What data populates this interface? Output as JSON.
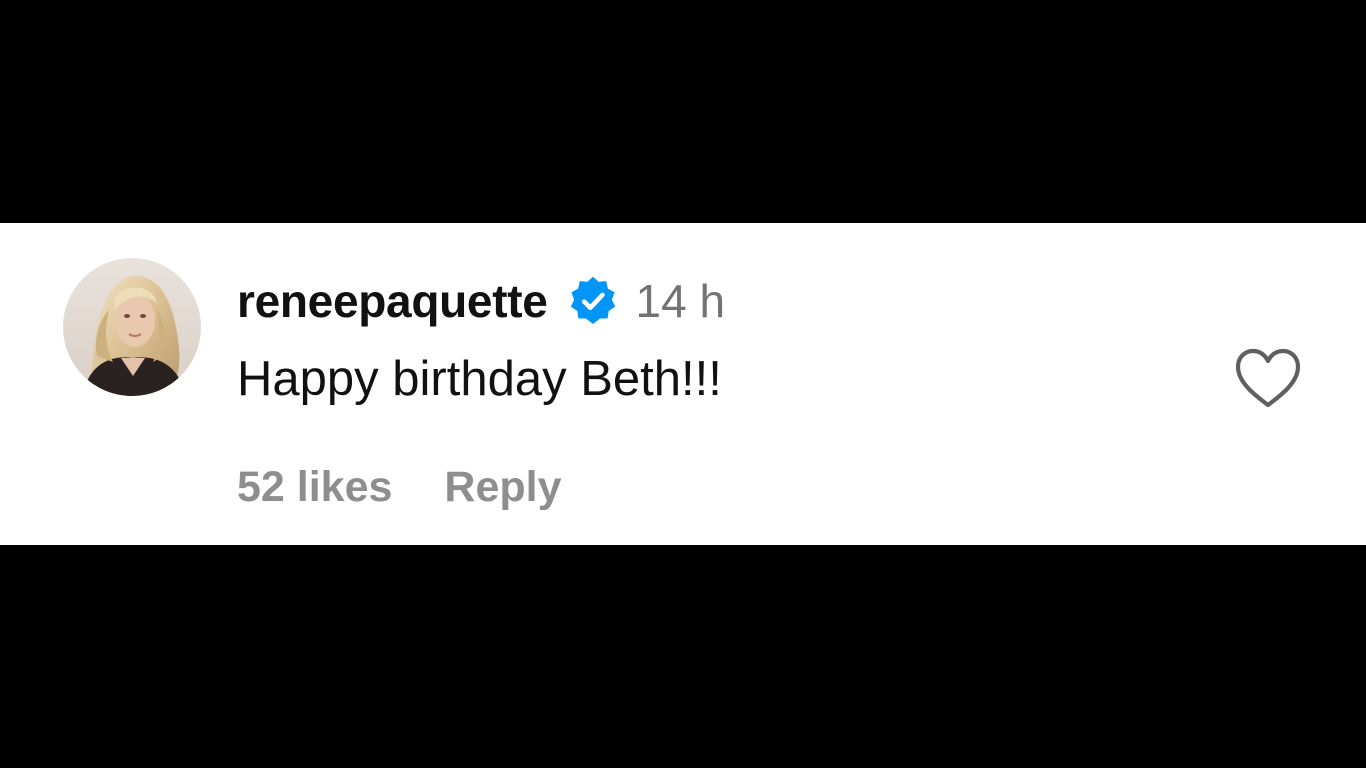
{
  "comment": {
    "username": "reneepaquette",
    "verified_icon": "verified-badge-icon",
    "timestamp": "14 h",
    "text": "Happy birthday Beth!!!",
    "likes_label": "52 likes",
    "reply_label": "Reply",
    "like_icon": "heart-outline-icon"
  },
  "colors": {
    "background_bars": "#000000",
    "panel": "#ffffff",
    "primary_text": "#111111",
    "secondary_text": "#737373",
    "action_text": "#8e8e8e",
    "verified_blue": "#0095f6"
  }
}
